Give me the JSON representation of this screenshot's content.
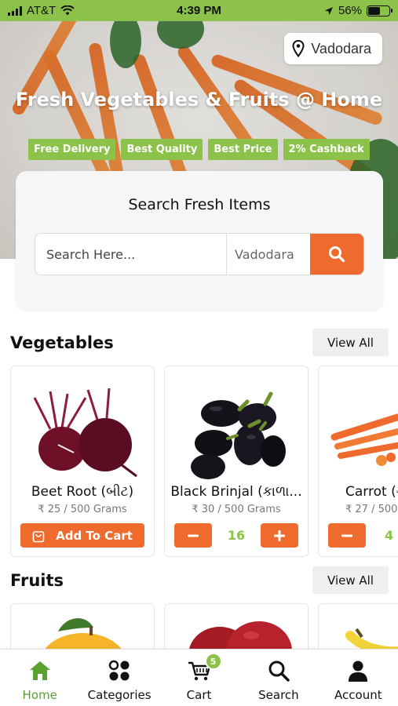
{
  "status_bar": {
    "carrier": "AT&T",
    "time": "4:39 PM",
    "battery": "56%",
    "battery_level": 0.56
  },
  "hero": {
    "location": "Vadodara",
    "title": "Fresh Vegetables & Fruits @ Home",
    "badges": [
      "Free Delivery",
      "Best Quality",
      "Best Price",
      "2% Cashback"
    ]
  },
  "search": {
    "title": "Search Fresh Items",
    "placeholder": "Search Here...",
    "city": "Vadodara"
  },
  "vegetables": {
    "title": "Vegetables",
    "view_all": "View All",
    "items": [
      {
        "name": "Beet Root (બીટ)",
        "price": "₹ 25 / 500 Grams",
        "action": "Add To Cart"
      },
      {
        "name": "Black Brinjal (કાળા...",
        "price": "₹ 30 / 500 Grams",
        "quantity": "16"
      },
      {
        "name": "Carrot (ગ",
        "price": "₹ 27 / 500",
        "quantity": "4"
      }
    ]
  },
  "fruits": {
    "title": "Fruits",
    "view_all": "View All"
  },
  "tab_bar": {
    "tabs": [
      {
        "label": "Home",
        "icon": "home-icon",
        "active": true
      },
      {
        "label": "Categories",
        "icon": "categories-icon"
      },
      {
        "label": "Cart",
        "icon": "cart-icon",
        "badge": "5"
      },
      {
        "label": "Search",
        "icon": "search-icon"
      },
      {
        "label": "Account",
        "icon": "account-icon"
      }
    ]
  },
  "colors": {
    "brand_green": "#8cc24a",
    "accent_orange": "#ef6a2d"
  }
}
